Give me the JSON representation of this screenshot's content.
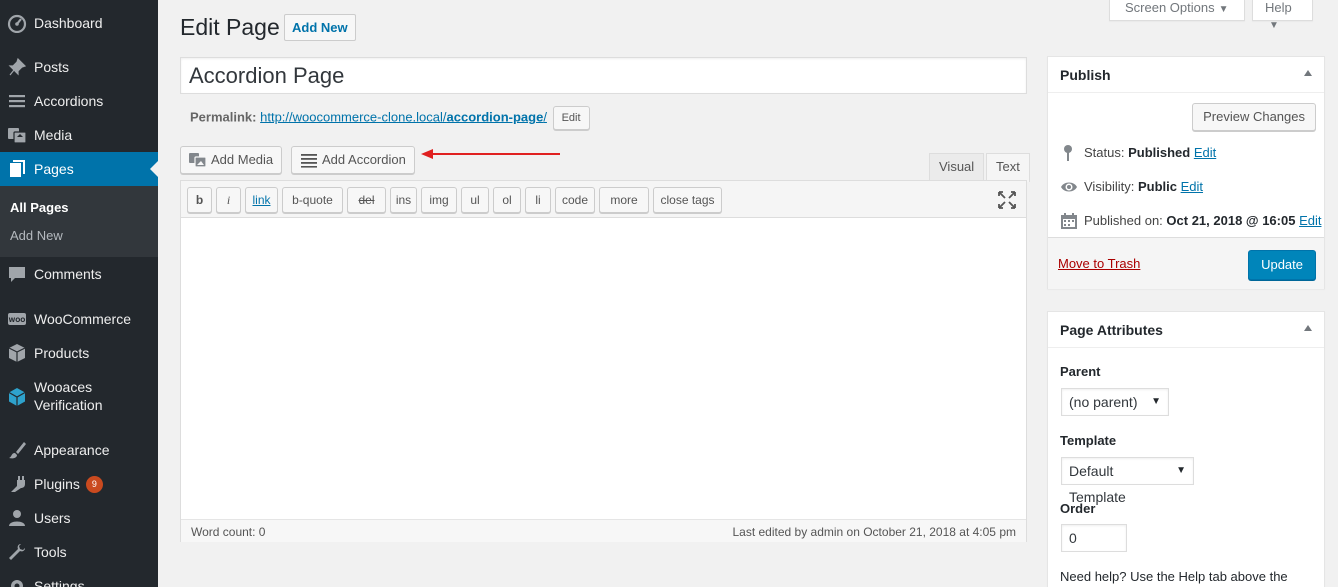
{
  "sidebar": {
    "dashboard": "Dashboard",
    "posts": "Posts",
    "accordions": "Accordions",
    "media": "Media",
    "pages": "Pages",
    "pages_sub_all": "All Pages",
    "pages_sub_add": "Add New",
    "comments": "Comments",
    "woocommerce": "WooCommerce",
    "products": "Products",
    "wooaces_line1": "Wooaces",
    "wooaces_line2": "Verification",
    "appearance": "Appearance",
    "plugins": "Plugins",
    "plugins_badge": "9",
    "users": "Users",
    "tools": "Tools",
    "settings": "Settings",
    "active_color": "#0073aa"
  },
  "header": {
    "title": "Edit Page",
    "add_new": "Add New",
    "screen_options": "Screen Options",
    "help": "Help"
  },
  "post": {
    "title": "Accordion Page",
    "permalink_label": "Permalink:",
    "permalink_base": "http://woocommerce-clone.local/",
    "permalink_slug": "accordion-page",
    "permalink_trailing": "/",
    "permalink_edit": "Edit"
  },
  "editor": {
    "add_media": "Add Media",
    "add_accordion": "Add Accordion",
    "tab_visual": "Visual",
    "tab_text": "Text",
    "quicktags": [
      "b",
      "i",
      "link",
      "b-quote",
      "del",
      "ins",
      "img",
      "ul",
      "ol",
      "li",
      "code",
      "more",
      "close tags"
    ],
    "word_count": "Word count: 0",
    "last_edited": "Last edited by admin on October 21, 2018 at 4:05 pm"
  },
  "publish": {
    "heading": "Publish",
    "preview": "Preview Changes",
    "status_label": "Status:",
    "status_value": "Published",
    "visibility_label": "Visibility:",
    "visibility_value": "Public",
    "published_label": "Published on:",
    "published_value": "Oct 21, 2018 @ 16:05",
    "edit": "Edit",
    "trash": "Move to Trash",
    "update": "Update"
  },
  "attributes": {
    "heading": "Page Attributes",
    "parent_label": "Parent",
    "parent_value": "(no parent)",
    "template_label": "Template",
    "template_value": "Default Template",
    "order_label": "Order",
    "order_value": "0",
    "help_text": "Need help? Use the Help tab above the"
  }
}
